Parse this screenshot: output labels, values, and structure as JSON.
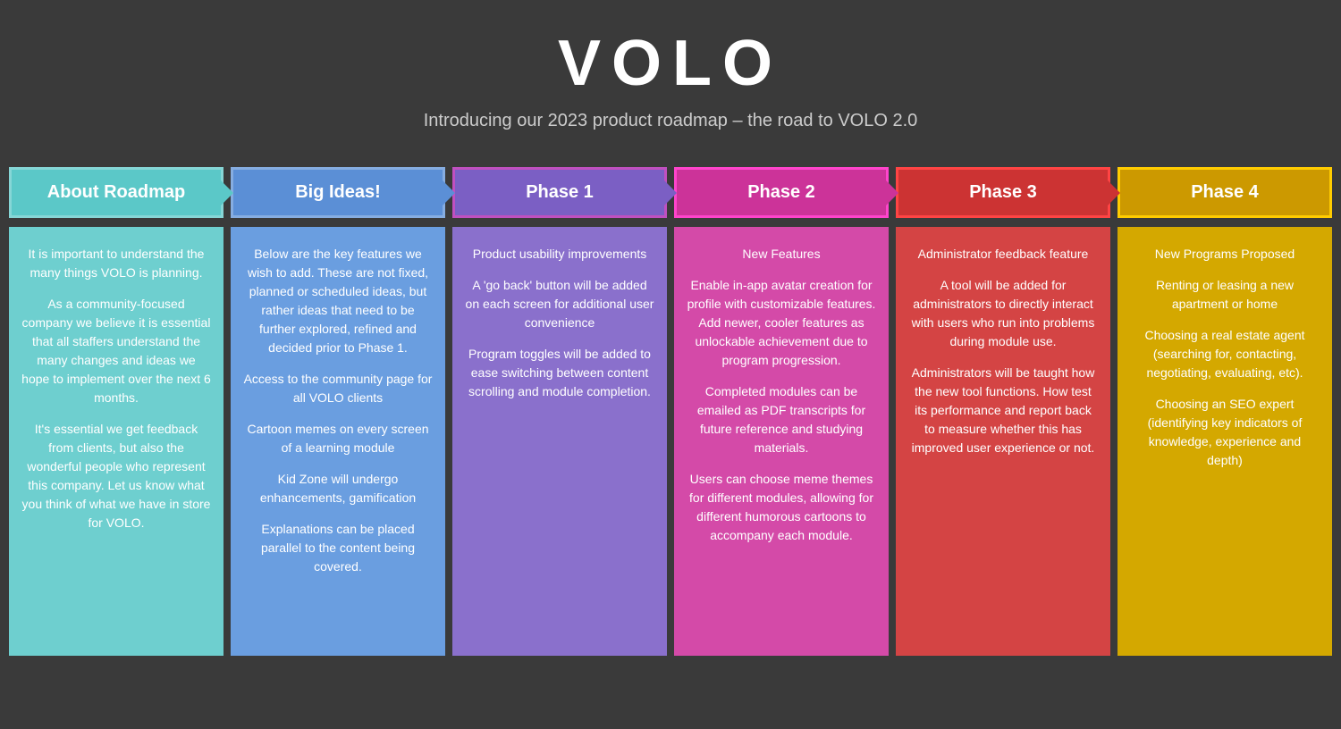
{
  "header": {
    "logo": "VOLO",
    "subtitle": "Introducing our 2023 product roadmap – the road to VOLO 2.0"
  },
  "columns": [
    {
      "id": "about",
      "header": "About Roadmap",
      "class": "col-about",
      "body": [
        "It is important to understand the many things VOLO is planning.",
        "As a community-focused company we believe it is essential that all staffers understand the many changes and ideas we hope to implement over the next 6 months.",
        "It's essential we get feedback from clients, but also the wonderful people who represent this company. Let us know what you think of what we have in store for VOLO."
      ]
    },
    {
      "id": "big-ideas",
      "header": "Big Ideas!",
      "class": "col-big",
      "body": [
        "Below are the key features we wish to add. These are not fixed, planned or scheduled ideas, but rather ideas that need to be further explored, refined and decided prior to Phase 1.",
        "Access to the community page for all VOLO clients",
        "Cartoon memes on every screen of a learning module",
        "Kid Zone will undergo enhancements, gamification",
        "Explanations can be placed parallel to the content being covered."
      ]
    },
    {
      "id": "phase1",
      "header": "Phase 1",
      "class": "col-phase1",
      "body": [
        "Product usability improvements",
        "A 'go back' button will be added on each screen for additional user convenience",
        "Program toggles will be added to ease switching between content scrolling and module completion."
      ]
    },
    {
      "id": "phase2",
      "header": "Phase 2",
      "class": "col-phase2",
      "body": [
        "New Features",
        "Enable in-app avatar creation for profile with customizable features. Add newer, cooler features as unlockable achievement due to program progression.",
        "Completed modules can be emailed as PDF transcripts for future reference and studying materials.",
        "Users can choose meme themes for different modules, allowing for different humorous cartoons to accompany each module."
      ]
    },
    {
      "id": "phase3",
      "header": "Phase 3",
      "class": "col-phase3",
      "body": [
        "Administrator feedback feature",
        "A tool will be added for administrators to directly interact with users who run into problems during module use.",
        "Administrators will be taught how the new tool functions. How test its performance and report back to measure whether this has improved user experience or not."
      ]
    },
    {
      "id": "phase4",
      "header": "Phase 4",
      "class": "col-phase4",
      "body": [
        "New Programs Proposed",
        "Renting or leasing a new apartment or home",
        "Choosing a real estate agent (searching for, contacting, negotiating, evaluating, etc).",
        "Choosing an SEO expert (identifying key indicators of knowledge, experience and depth)"
      ]
    }
  ]
}
